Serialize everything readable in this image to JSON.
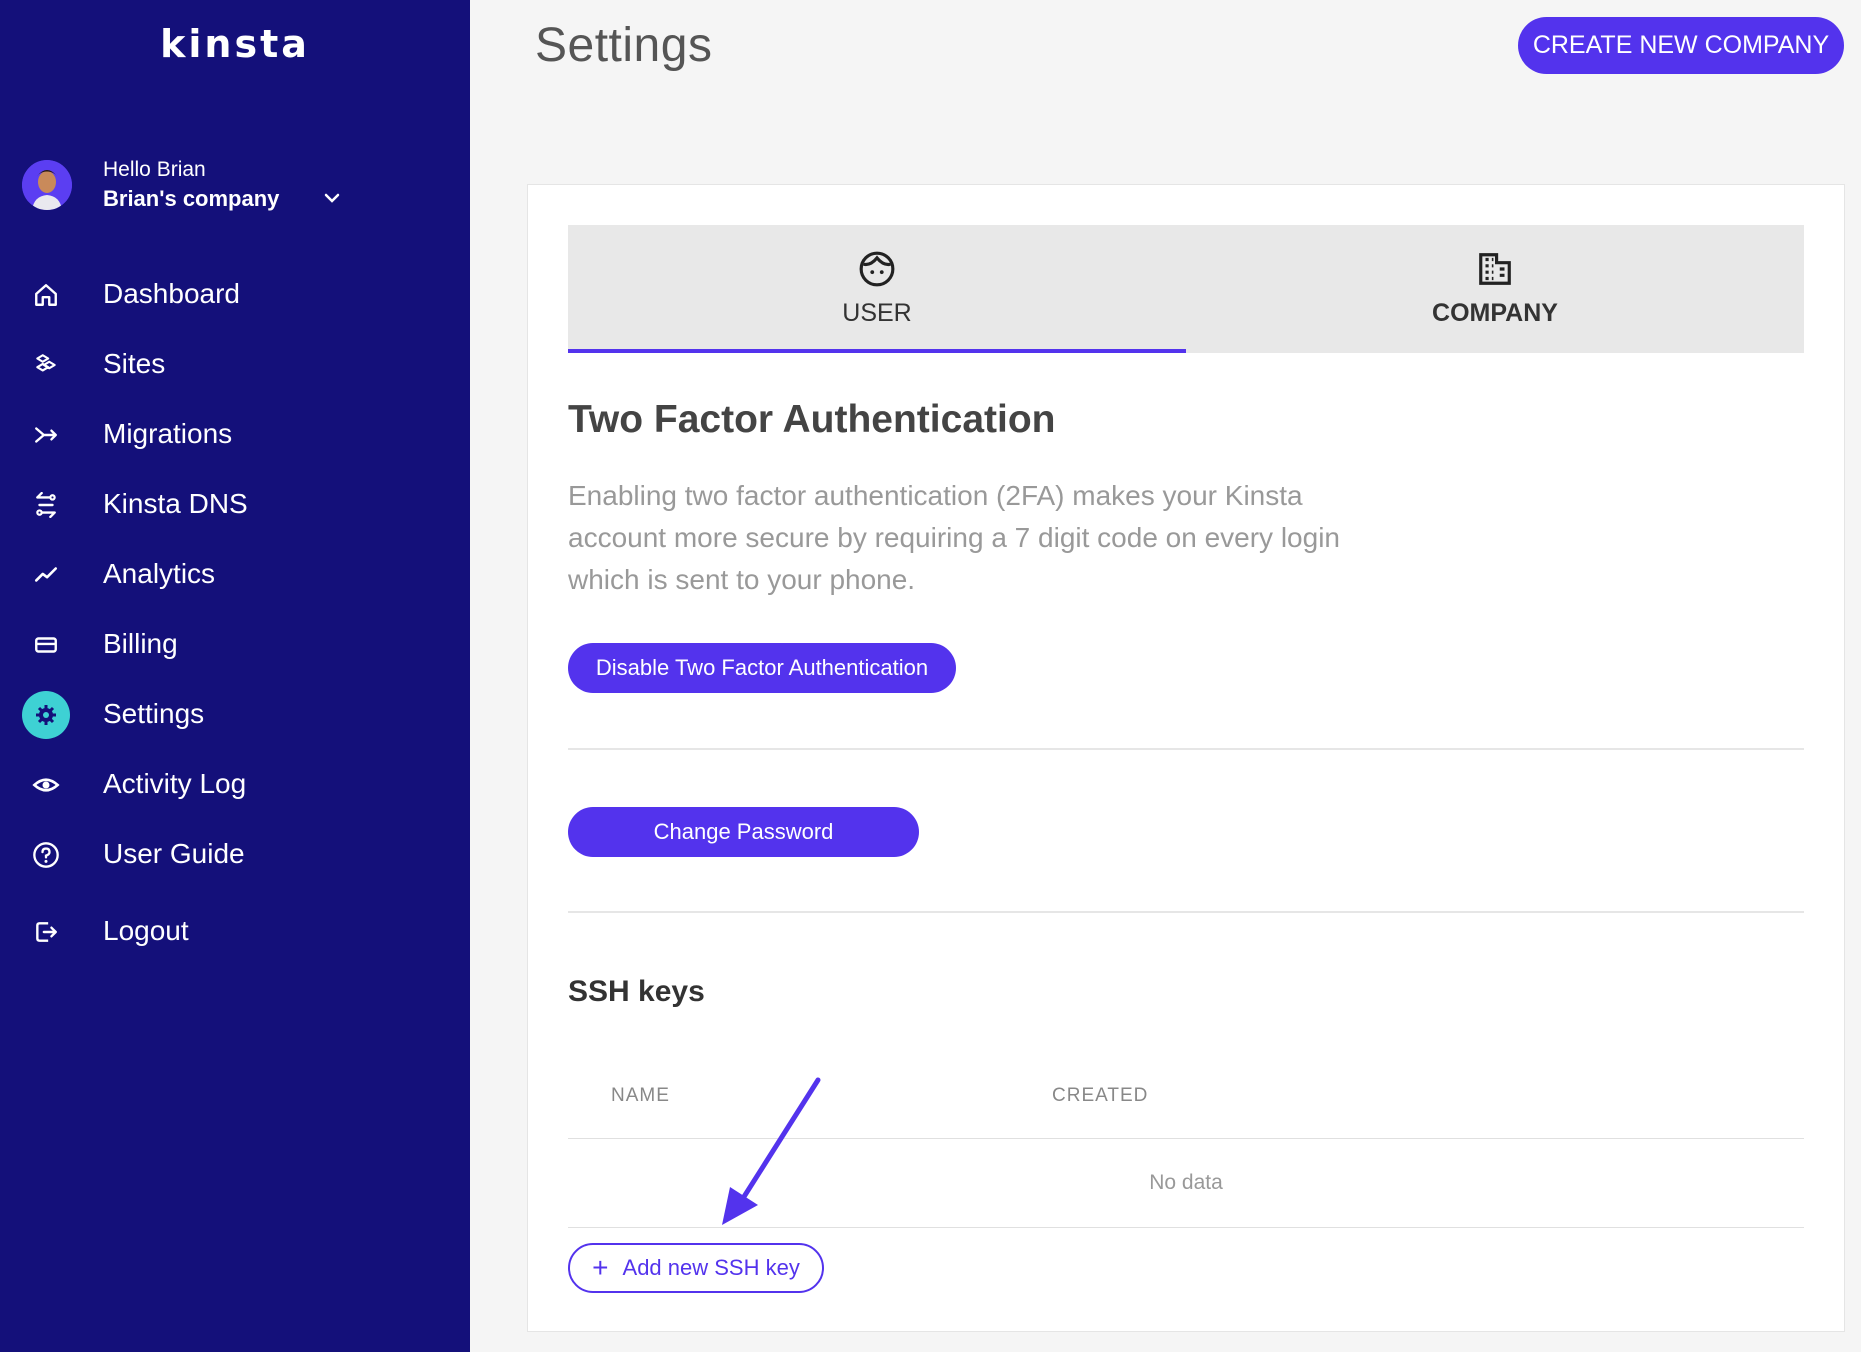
{
  "sidebar": {
    "logo": "kinsta",
    "greeting": "Hello Brian",
    "company": "Brian's company",
    "items": [
      {
        "label": "Dashboard",
        "icon": "home-icon"
      },
      {
        "label": "Sites",
        "icon": "sites-icon"
      },
      {
        "label": "Migrations",
        "icon": "migrations-icon"
      },
      {
        "label": "Kinsta DNS",
        "icon": "dns-icon"
      },
      {
        "label": "Analytics",
        "icon": "analytics-icon"
      },
      {
        "label": "Billing",
        "icon": "billing-icon"
      },
      {
        "label": "Settings",
        "icon": "gear-icon",
        "active": true
      },
      {
        "label": "Activity Log",
        "icon": "eye-icon"
      },
      {
        "label": "User Guide",
        "icon": "help-icon"
      },
      {
        "label": "Logout",
        "icon": "logout-icon"
      }
    ]
  },
  "header": {
    "title": "Settings",
    "create_button": "CREATE NEW COMPANY"
  },
  "tabs": [
    {
      "label": "USER",
      "icon": "user-face-icon",
      "active": true
    },
    {
      "label": "COMPANY",
      "icon": "building-icon"
    }
  ],
  "two_factor": {
    "title": "Two Factor Authentication",
    "description": "Enabling two factor authentication (2FA) makes your Kinsta account more secure by requiring a 7 digit code on every login which is sent to your phone.",
    "button": "Disable Two Factor Authentication"
  },
  "password": {
    "button": "Change Password"
  },
  "ssh": {
    "title": "SSH keys",
    "columns": [
      "NAME",
      "CREATED"
    ],
    "empty_text": "No data",
    "add_button": "Add new SSH key"
  },
  "colors": {
    "sidebar_bg": "#14107a",
    "accent": "#5333ed",
    "active_icon_bg": "#3ed1d4"
  }
}
